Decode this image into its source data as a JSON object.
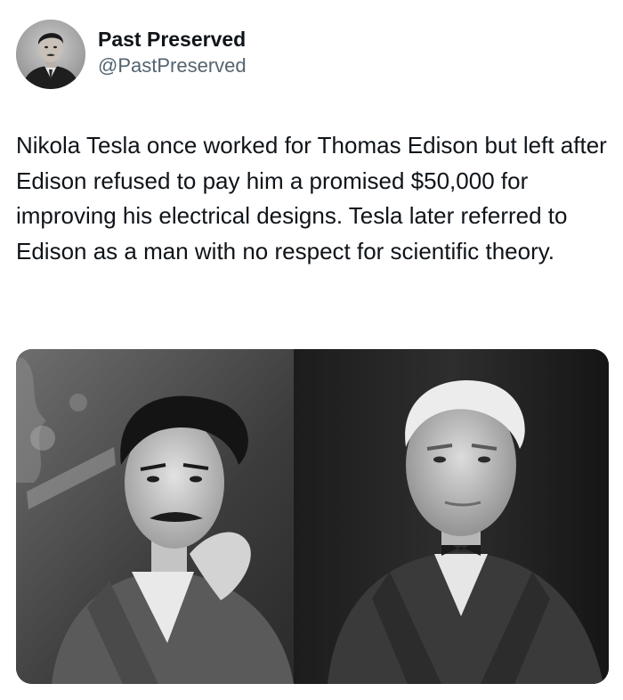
{
  "post": {
    "author": {
      "display_name": "Past Preserved",
      "handle": "@PastPreserved",
      "avatar_icon": "profile-photo"
    },
    "text": "Nikola Tesla once worked for Thomas Edison but left after Edison refused to pay him a promised $50,000 for improving his electrical designs. Tesla later referred to Edison as a man with no respect for scientific theory.",
    "media": {
      "type": "photo-collage",
      "panels": [
        "left-portrait",
        "right-portrait"
      ]
    }
  }
}
